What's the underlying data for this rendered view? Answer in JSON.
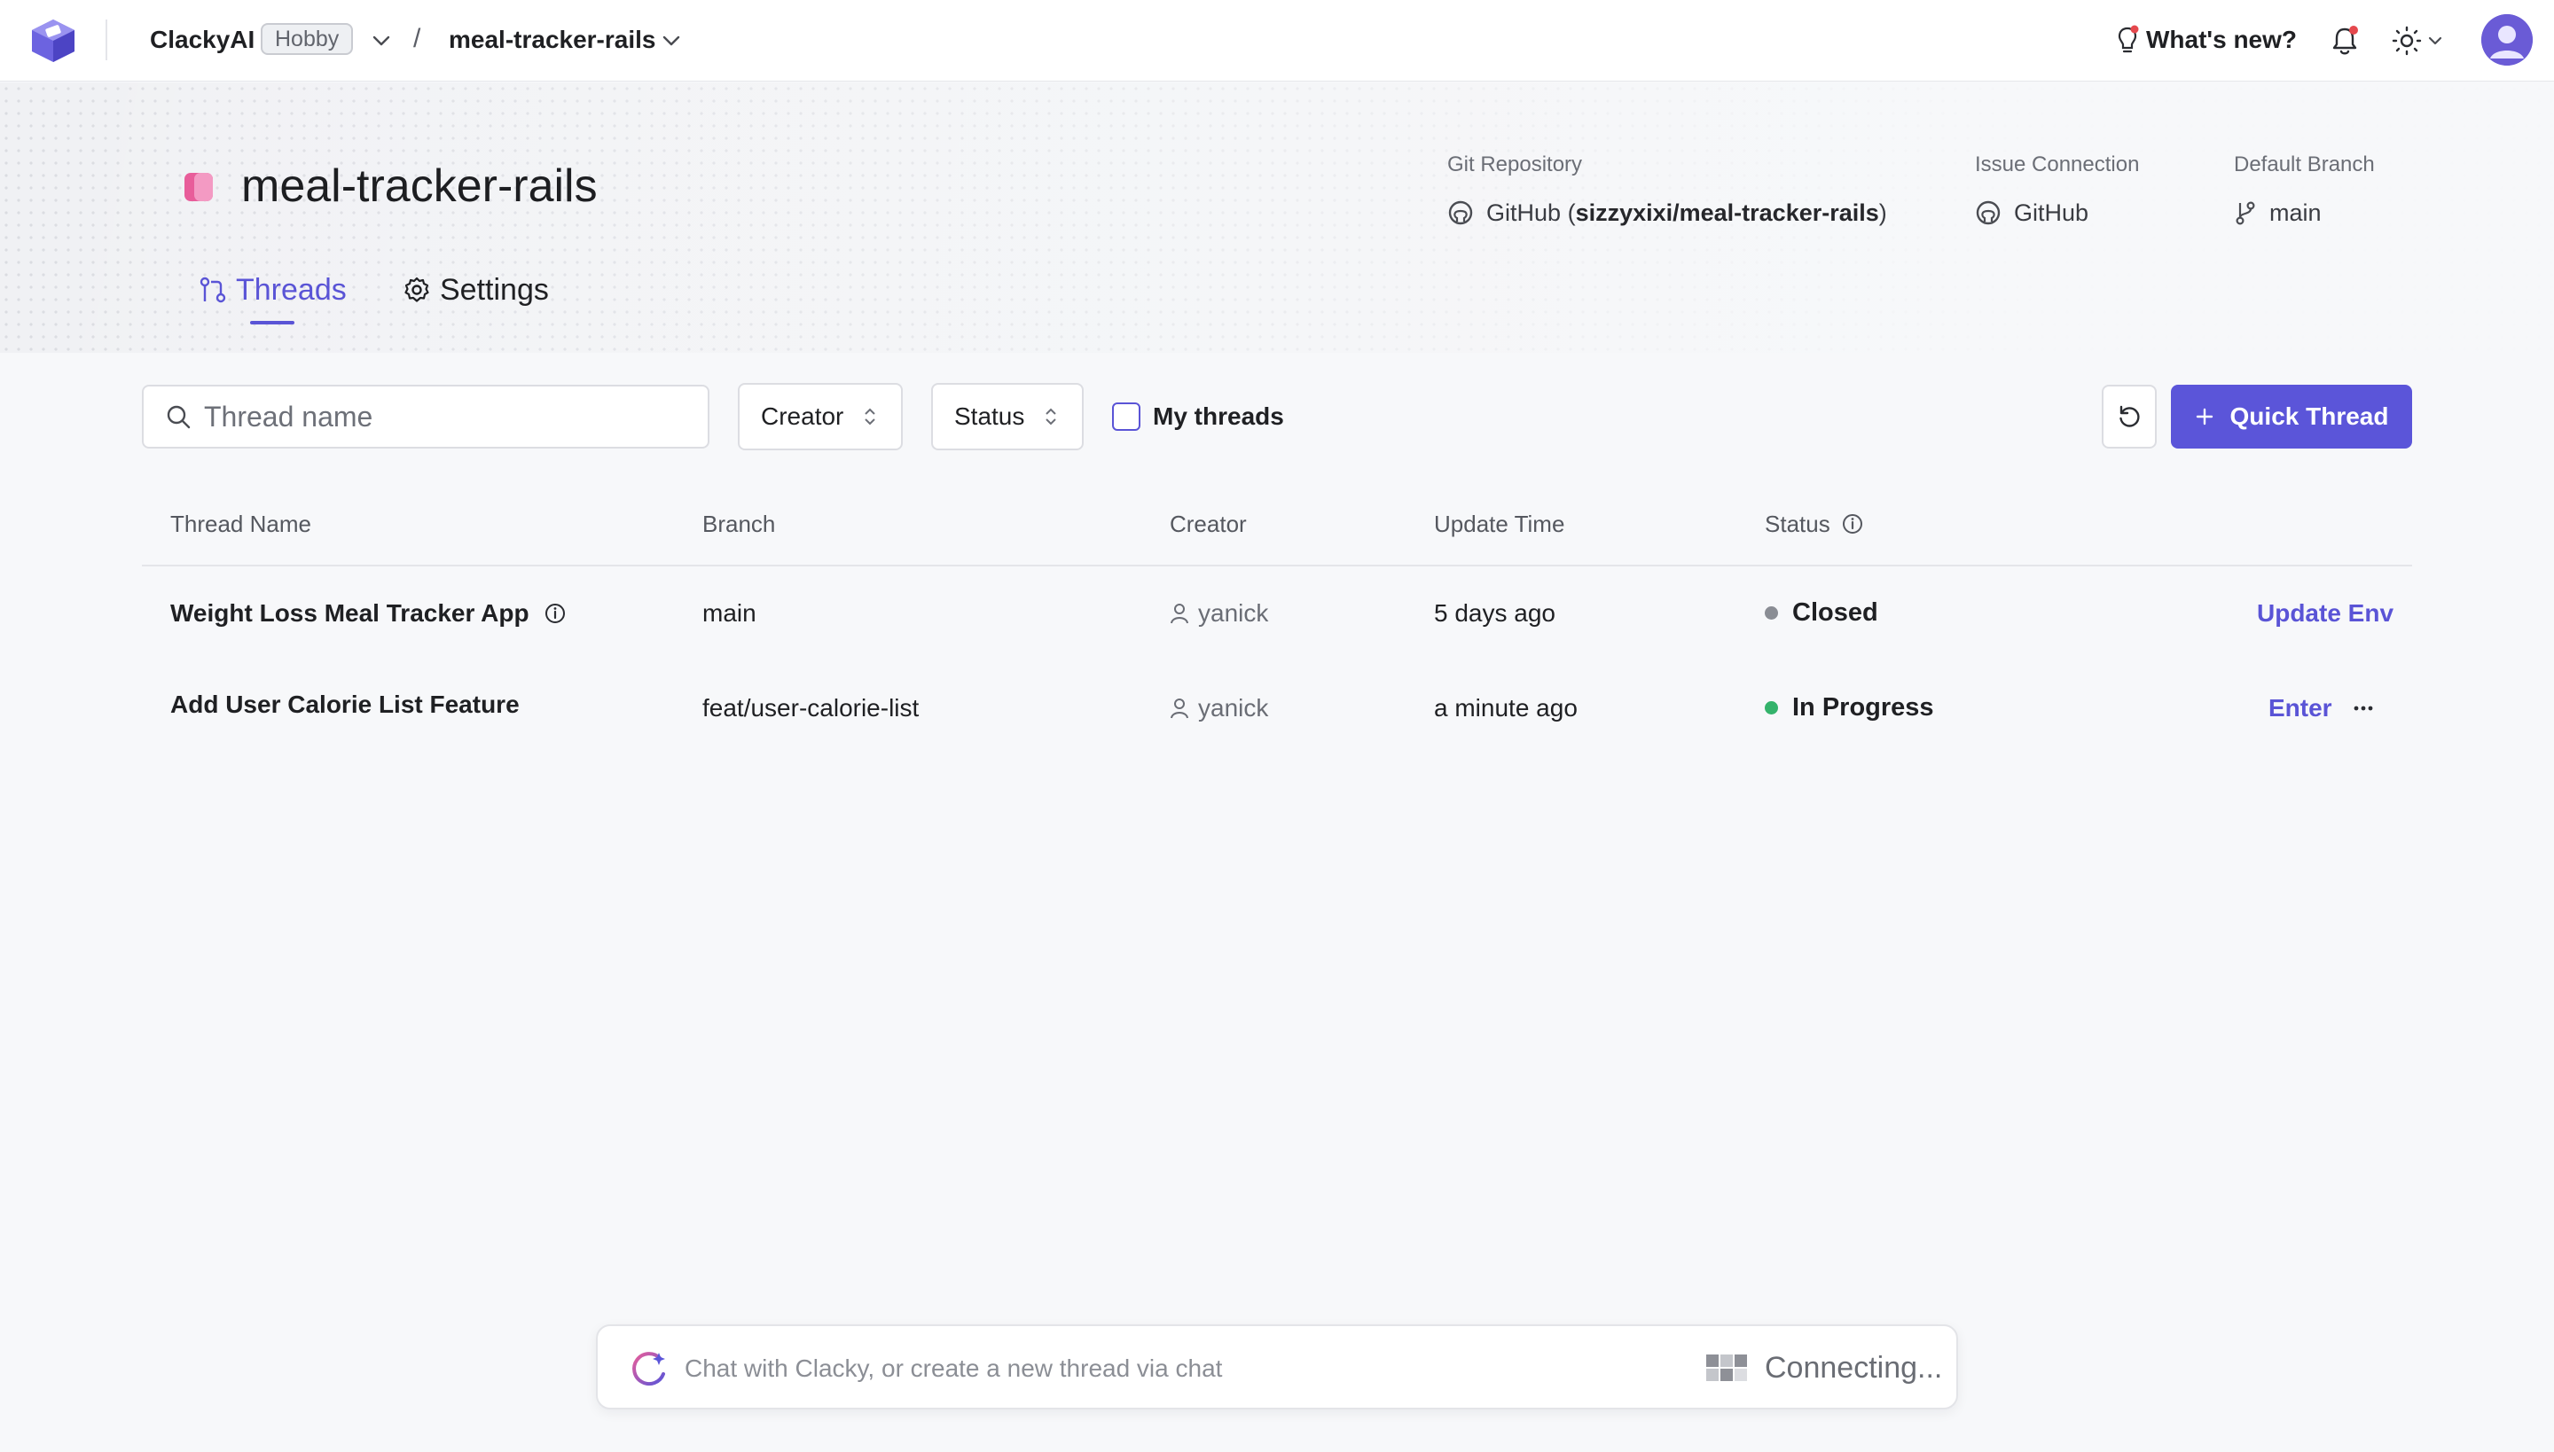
{
  "topbar": {
    "org_name": "ClackyAI",
    "plan_badge": "Hobby",
    "breadcrumb_separator": "/",
    "project_name": "meal-tracker-rails",
    "whats_new_label": "What's new?"
  },
  "project": {
    "title": "meal-tracker-rails",
    "icon_color": "#e85d9a",
    "git_repository": {
      "label": "Git Repository",
      "provider": "GitHub",
      "open_paren": "(",
      "repo": "sizzyxixi/meal-tracker-rails",
      "close_paren": ")"
    },
    "issue_connection": {
      "label": "Issue Connection",
      "value": "GitHub"
    },
    "default_branch": {
      "label": "Default Branch",
      "value": "main"
    }
  },
  "tabs": [
    {
      "label": "Threads",
      "active": true
    },
    {
      "label": "Settings",
      "active": false
    }
  ],
  "filters": {
    "search_placeholder": "Thread name",
    "creator_label": "Creator",
    "status_label": "Status",
    "my_threads_label": "My threads",
    "my_threads_checked": false,
    "quick_thread_label": "Quick Thread"
  },
  "table": {
    "columns": [
      "Thread Name",
      "Branch",
      "Creator",
      "Update Time",
      "Status"
    ],
    "rows": [
      {
        "name": "Weight Loss Meal Tracker App",
        "branch": "main",
        "creator": "yanick",
        "update_time": "5 days ago",
        "status": "Closed",
        "status_color": "#8a8d94",
        "action": "Update Env"
      },
      {
        "name": "Add User Calorie List Feature",
        "branch": "feat/user-calorie-list",
        "creator": "yanick",
        "update_time": "a minute ago",
        "status": "In Progress",
        "status_color": "#34b36b",
        "action": "Enter"
      }
    ]
  },
  "chat": {
    "placeholder": "Chat with Clacky, or create a new thread via chat",
    "connection_status": "Connecting..."
  },
  "colors": {
    "accent": "#5b55d9",
    "background": "#f7f8fa"
  }
}
